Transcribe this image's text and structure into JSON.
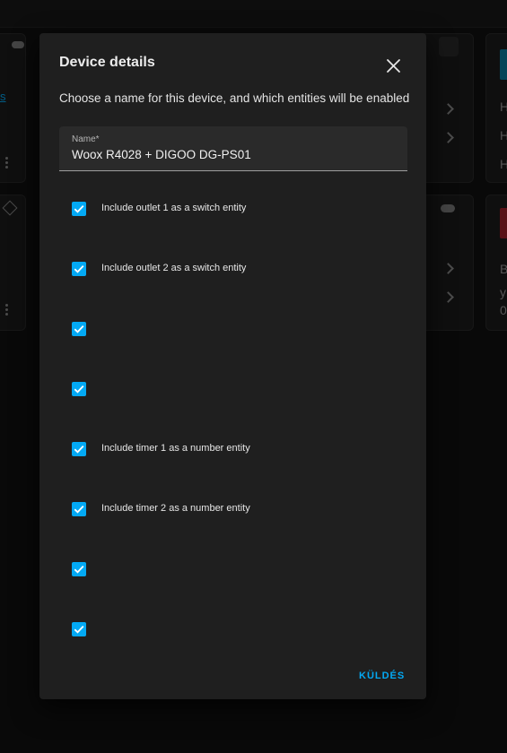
{
  "dialog": {
    "title": "Device details",
    "description": "Choose a name for this device, and which entities will be enabled",
    "name_field": {
      "label": "Name*",
      "value": "Woox R4028 + DIGOO DG-PS01"
    },
    "options": [
      {
        "label": "Include outlet 1 as a switch entity",
        "checked": true
      },
      {
        "label": "Include outlet 2 as a switch entity",
        "checked": true
      },
      {
        "label": "",
        "checked": true
      },
      {
        "label": "",
        "checked": true
      },
      {
        "label": "Include timer 1 as a number entity",
        "checked": true
      },
      {
        "label": "Include timer 2 as a number entity",
        "checked": true
      },
      {
        "label": "",
        "checked": true
      },
      {
        "label": "",
        "checked": true
      }
    ],
    "submit_label": "KÜLDÉS"
  },
  "background": {
    "right_card_1_lines": [
      "H",
      "H",
      "H"
    ],
    "right_card_2_lines": [
      "B",
      "y",
      "0"
    ]
  },
  "colors": {
    "accent": "#03a9f4",
    "dialog_bg": "#1f1f1f",
    "page_bg": "#111111",
    "alert": "#a3202a"
  }
}
